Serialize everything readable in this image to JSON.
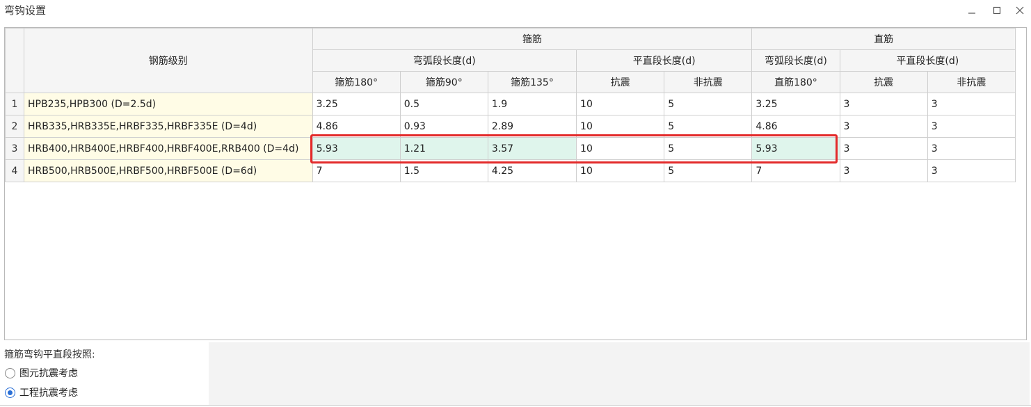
{
  "window": {
    "title": "弯钩设置",
    "minimize_icon": "minimize-icon",
    "maximize_icon": "maximize-icon",
    "close_icon": "close-icon"
  },
  "table": {
    "header": {
      "grade": "钢筋级别",
      "stirrup_group": "箍筋",
      "straight_group": "直筋",
      "stirrup_arc": "弯弧段长度(d)",
      "stirrup_flat": "平直段长度(d)",
      "straight_arc": "弯弧段长度(d)",
      "straight_flat": "平直段长度(d)",
      "cols": [
        "箍筋180°",
        "箍筋90°",
        "箍筋135°",
        "抗震",
        "非抗震",
        "直筋180°",
        "抗震",
        "非抗震"
      ]
    },
    "rows": [
      {
        "num": "1",
        "grade": "HPB235,HPB300 (D=2.5d)",
        "values": [
          "3.25",
          "0.5",
          "1.9",
          "10",
          "5",
          "3.25",
          "3",
          "3"
        ]
      },
      {
        "num": "2",
        "grade": "HRB335,HRB335E,HRBF335,HRBF335E (D=4d)",
        "values": [
          "4.86",
          "0.93",
          "2.89",
          "10",
          "5",
          "4.86",
          "3",
          "3"
        ]
      },
      {
        "num": "3",
        "grade": "HRB400,HRB400E,HRBF400,HRBF400E,RRB400 (D=4d)",
        "values": [
          "5.93",
          "1.21",
          "3.57",
          "10",
          "5",
          "5.93",
          "3",
          "3"
        ]
      },
      {
        "num": "4",
        "grade": "HRB500,HRB500E,HRBF500,HRBF500E (D=6d)",
        "values": [
          "7",
          "1.5",
          "4.25",
          "10",
          "5",
          "7",
          "3",
          "3"
        ]
      }
    ],
    "highlight_color": "#dff5ec",
    "annotation_color": "#e32a2a"
  },
  "options": {
    "label": "箍筋弯钩平直段按照:",
    "radios": [
      {
        "label": "图元抗震考虑",
        "checked": false
      },
      {
        "label": "工程抗震考虑",
        "checked": true
      }
    ]
  }
}
